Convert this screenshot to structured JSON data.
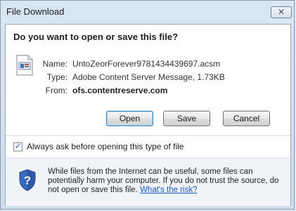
{
  "window": {
    "title": "File Download",
    "close_glyph": "✕"
  },
  "dialog": {
    "question": "Do you want to open or save this file?",
    "file": {
      "name_label": "Name:",
      "name_value": "UntoZeorForever9781434439697.acsm",
      "type_label": "Type:",
      "type_value": "Adobe Content Server Message, 1.73KB",
      "from_label": "From:",
      "from_value": "ofs.contentreserve.com",
      "icon": "document-icon"
    },
    "buttons": {
      "open": "Open",
      "save": "Save",
      "cancel": "Cancel"
    },
    "checkbox": {
      "label": "Always ask before opening this type of file",
      "checked": true,
      "glyph": "✓"
    },
    "warning": {
      "icon": "shield-question-icon",
      "text": "While files from the Internet can be useful, some files can potentially harm your computer. If you do not trust the source, do not open or save this file.",
      "link": "What's the risk?"
    }
  }
}
